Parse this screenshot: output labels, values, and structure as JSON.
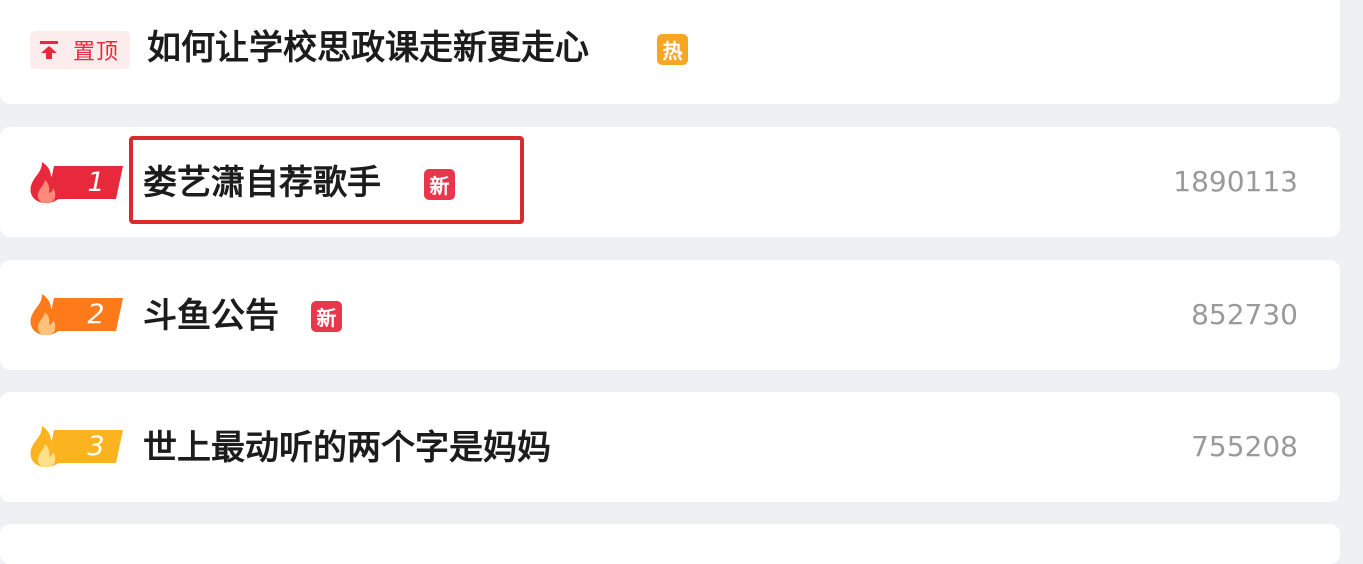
{
  "pinned": {
    "badge_label": "置顶",
    "badge_icon": "pin-top-icon",
    "title": "如何让学校思政课走新更走心",
    "tag": "热",
    "tag_color": "#f5a623"
  },
  "rows": [
    {
      "rank": "1",
      "title": "娄艺潇自荐歌手",
      "tag": "新",
      "count": "1890113",
      "flame_color": "#e8283b",
      "highlighted": true
    },
    {
      "rank": "2",
      "title": "斗鱼公告",
      "tag": "新",
      "count": "852730",
      "flame_color": "#ff7a1a"
    },
    {
      "rank": "3",
      "title": "世上最动听的两个字是妈妈",
      "tag": "",
      "count": "755208",
      "flame_color": "#fbb41f"
    }
  ],
  "colors": {
    "new_tag": "#e8374c",
    "hot_tag": "#f5a623",
    "highlight_border": "#d92b2b",
    "count_text": "#9a9a9a"
  }
}
